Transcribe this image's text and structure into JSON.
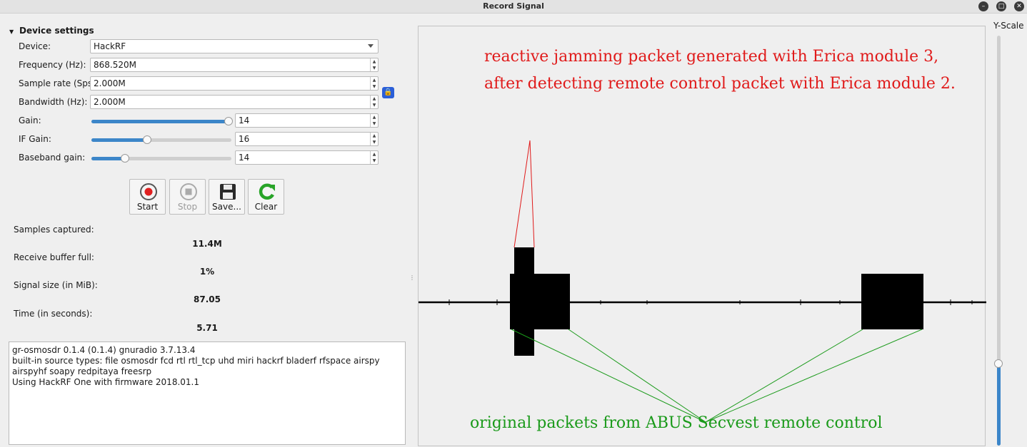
{
  "window": {
    "title": "Record Signal"
  },
  "device_settings": {
    "header": "Device settings",
    "device": {
      "label": "Device:",
      "value": "HackRF"
    },
    "frequency": {
      "label": "Frequency (Hz):",
      "value": "868.520M"
    },
    "sample_rate": {
      "label": "Sample rate (Sps):",
      "value": "2.000M"
    },
    "bandwidth": {
      "label": "Bandwidth (Hz):",
      "value": "2.000M"
    },
    "gain": {
      "label": "Gain:",
      "value": "14",
      "slider_fraction": 0.98
    },
    "if_gain": {
      "label": "IF Gain:",
      "value": "16",
      "slider_fraction": 0.4
    },
    "baseband_gain": {
      "label": "Baseband gain:",
      "value": "14",
      "slider_fraction": 0.24
    }
  },
  "toolbar": {
    "start": "Start",
    "stop": "Stop",
    "save": "Save...",
    "clear": "Clear"
  },
  "stats": {
    "samples_captured": {
      "label": "Samples captured:",
      "value": "11.4M"
    },
    "receive_buffer": {
      "label": "Receive buffer full:",
      "value": "1%"
    },
    "signal_size": {
      "label": "Signal size (in MiB):",
      "value": "87.05"
    },
    "time": {
      "label": "Time (in seconds):",
      "value": "5.71"
    }
  },
  "log": [
    "gr-osmosdr 0.1.4 (0.1.4) gnuradio 3.7.13.4",
    "built-in source types: file osmosdr fcd rtl rtl_tcp uhd miri hackrf bladerf rfspace airspy airspyhf soapy redpitaya freesrp",
    "Using HackRF One with firmware 2018.01.1"
  ],
  "graph": {
    "y_scale_label": "Y-Scale",
    "y_scale_fraction": 0.2,
    "annotation_red_line1": "reactive jamming packet generated with Erica module 3,",
    "annotation_red_line2": "after detecting remote control packet with Erica module 2.",
    "annotation_green": "original packets from ABUS Secvest remote control",
    "colors": {
      "red": "#e01a1a",
      "green": "#1a9a1a",
      "signal": "#000000"
    }
  }
}
